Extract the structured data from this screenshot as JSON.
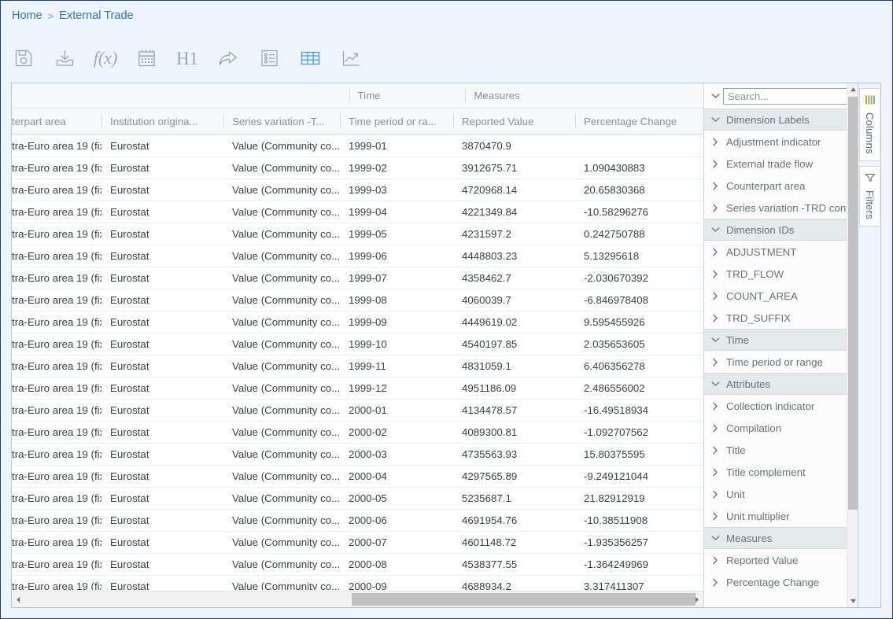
{
  "breadcrumb": {
    "items": [
      {
        "label": "Home"
      },
      {
        "label": "External Trade"
      }
    ],
    "separator": ">"
  },
  "toolbar": {
    "buttons": [
      {
        "name": "save-icon",
        "label": "",
        "title": "Save"
      },
      {
        "name": "download-icon",
        "label": "",
        "title": "Download"
      },
      {
        "name": "function-icon",
        "label": "f(x)",
        "title": "Function"
      },
      {
        "name": "calendar-icon",
        "label": "",
        "title": "Calendar"
      },
      {
        "name": "heading-one-icon",
        "label": "H1",
        "title": "Heading 1"
      },
      {
        "name": "share-arrow-icon",
        "label": "",
        "title": "Share"
      },
      {
        "name": "list-details-icon",
        "label": "",
        "title": "Details"
      },
      {
        "name": "table-grid-icon",
        "label": "",
        "title": "Table"
      },
      {
        "name": "line-chart-icon",
        "label": "",
        "title": "Chart"
      }
    ]
  },
  "grid": {
    "group_headers": [
      {
        "label": ""
      },
      {
        "label": "Time"
      },
      {
        "label": "Measures"
      }
    ],
    "columns": [
      {
        "label": "terpart area"
      },
      {
        "label": "Institution origina..."
      },
      {
        "label": "Series variation -T..."
      },
      {
        "label": "Time period or ra..."
      },
      {
        "label": "Reported Value"
      },
      {
        "label": "Percentage Change"
      }
    ],
    "rows": [
      {
        "counterpart": "tra-Euro area 19 (fix...",
        "institution": "Eurostat",
        "variation": "Value (Community co...",
        "period": "1999-01",
        "value": "3870470.9",
        "pct": ""
      },
      {
        "counterpart": "tra-Euro area 19 (fix...",
        "institution": "Eurostat",
        "variation": "Value (Community co...",
        "period": "1999-02",
        "value": "3912675.71",
        "pct": "1.090430883"
      },
      {
        "counterpart": "tra-Euro area 19 (fix...",
        "institution": "Eurostat",
        "variation": "Value (Community co...",
        "period": "1999-03",
        "value": "4720968.14",
        "pct": "20.65830368"
      },
      {
        "counterpart": "tra-Euro area 19 (fix...",
        "institution": "Eurostat",
        "variation": "Value (Community co...",
        "period": "1999-04",
        "value": "4221349.84",
        "pct": "-10.58296276"
      },
      {
        "counterpart": "tra-Euro area 19 (fix...",
        "institution": "Eurostat",
        "variation": "Value (Community co...",
        "period": "1999-05",
        "value": "4231597.2",
        "pct": "0.242750788"
      },
      {
        "counterpart": "tra-Euro area 19 (fix...",
        "institution": "Eurostat",
        "variation": "Value (Community co...",
        "period": "1999-06",
        "value": "4448803.23",
        "pct": "5.13295618"
      },
      {
        "counterpart": "tra-Euro area 19 (fix...",
        "institution": "Eurostat",
        "variation": "Value (Community co...",
        "period": "1999-07",
        "value": "4358462.7",
        "pct": "-2.030670392"
      },
      {
        "counterpart": "tra-Euro area 19 (fix...",
        "institution": "Eurostat",
        "variation": "Value (Community co...",
        "period": "1999-08",
        "value": "4060039.7",
        "pct": "-6.846978408"
      },
      {
        "counterpart": "tra-Euro area 19 (fix...",
        "institution": "Eurostat",
        "variation": "Value (Community co...",
        "period": "1999-09",
        "value": "4449619.02",
        "pct": "9.595455926"
      },
      {
        "counterpart": "tra-Euro area 19 (fix...",
        "institution": "Eurostat",
        "variation": "Value (Community co...",
        "period": "1999-10",
        "value": "4540197.85",
        "pct": "2.035653605"
      },
      {
        "counterpart": "tra-Euro area 19 (fix...",
        "institution": "Eurostat",
        "variation": "Value (Community co...",
        "period": "1999-11",
        "value": "4831059.1",
        "pct": "6.406356278"
      },
      {
        "counterpart": "tra-Euro area 19 (fix...",
        "institution": "Eurostat",
        "variation": "Value (Community co...",
        "period": "1999-12",
        "value": "4951186.09",
        "pct": "2.486556002"
      },
      {
        "counterpart": "tra-Euro area 19 (fix...",
        "institution": "Eurostat",
        "variation": "Value (Community co...",
        "period": "2000-01",
        "value": "4134478.57",
        "pct": "-16.49518934"
      },
      {
        "counterpart": "tra-Euro area 19 (fix...",
        "institution": "Eurostat",
        "variation": "Value (Community co...",
        "period": "2000-02",
        "value": "4089300.81",
        "pct": "-1.092707562"
      },
      {
        "counterpart": "tra-Euro area 19 (fix...",
        "institution": "Eurostat",
        "variation": "Value (Community co...",
        "period": "2000-03",
        "value": "4735563.93",
        "pct": "15.80375595"
      },
      {
        "counterpart": "tra-Euro area 19 (fix...",
        "institution": "Eurostat",
        "variation": "Value (Community co...",
        "period": "2000-04",
        "value": "4297565.89",
        "pct": "-9.249121044"
      },
      {
        "counterpart": "tra-Euro area 19 (fix...",
        "institution": "Eurostat",
        "variation": "Value (Community co...",
        "period": "2000-05",
        "value": "5235687.1",
        "pct": "21.82912919"
      },
      {
        "counterpart": "tra-Euro area 19 (fix...",
        "institution": "Eurostat",
        "variation": "Value (Community co...",
        "period": "2000-06",
        "value": "4691954.76",
        "pct": "-10.38511908"
      },
      {
        "counterpart": "tra-Euro area 19 (fix...",
        "institution": "Eurostat",
        "variation": "Value (Community co...",
        "period": "2000-07",
        "value": "4601148.72",
        "pct": "-1.935356257"
      },
      {
        "counterpart": "tra-Euro area 19 (fix...",
        "institution": "Eurostat",
        "variation": "Value (Community co...",
        "period": "2000-08",
        "value": "4538377.55",
        "pct": "-1.364249969"
      },
      {
        "counterpart": "tra-Euro area 19 (fix...",
        "institution": "Eurostat",
        "variation": "Value (Community co...",
        "period": "2000-09",
        "value": "4688934.2",
        "pct": "3.317411307"
      }
    ]
  },
  "side_panel": {
    "search": {
      "placeholder": "Search...",
      "value": ""
    },
    "sections": [
      {
        "title": "Dimension Labels",
        "expanded": true,
        "items": [
          {
            "label": "Adjustment indicator"
          },
          {
            "label": "External trade flow"
          },
          {
            "label": "Counterpart area"
          },
          {
            "label": "Series variation -TRD contex"
          }
        ]
      },
      {
        "title": "Dimension IDs",
        "expanded": true,
        "items": [
          {
            "label": "ADJUSTMENT"
          },
          {
            "label": "TRD_FLOW"
          },
          {
            "label": "COUNT_AREA"
          },
          {
            "label": "TRD_SUFFIX"
          }
        ]
      },
      {
        "title": "Time",
        "expanded": true,
        "items": [
          {
            "label": "Time period or range"
          }
        ]
      },
      {
        "title": "Attributes",
        "expanded": true,
        "items": [
          {
            "label": "Collection indicator"
          },
          {
            "label": "Compilation"
          },
          {
            "label": "Title"
          },
          {
            "label": "Title complement"
          },
          {
            "label": "Unit"
          },
          {
            "label": "Unit multiplier"
          }
        ]
      },
      {
        "title": "Measures",
        "expanded": true,
        "items": [
          {
            "label": "Reported Value"
          },
          {
            "label": "Percentage Change"
          }
        ]
      }
    ]
  },
  "vertical_tabs": [
    {
      "label": "Columns",
      "icon": "columns-icon",
      "active": true
    },
    {
      "label": "Filters",
      "icon": "filter-icon",
      "active": false
    }
  ],
  "colors": {
    "breadcrumb_link": "#2f74bd",
    "page_background": "#eef4fb",
    "panel_border": "#b9c4cf",
    "section_header_bg": "#e4eaec",
    "toolbar_icon": "#9aa7b4",
    "grid_accent": "#4a9fd6"
  }
}
